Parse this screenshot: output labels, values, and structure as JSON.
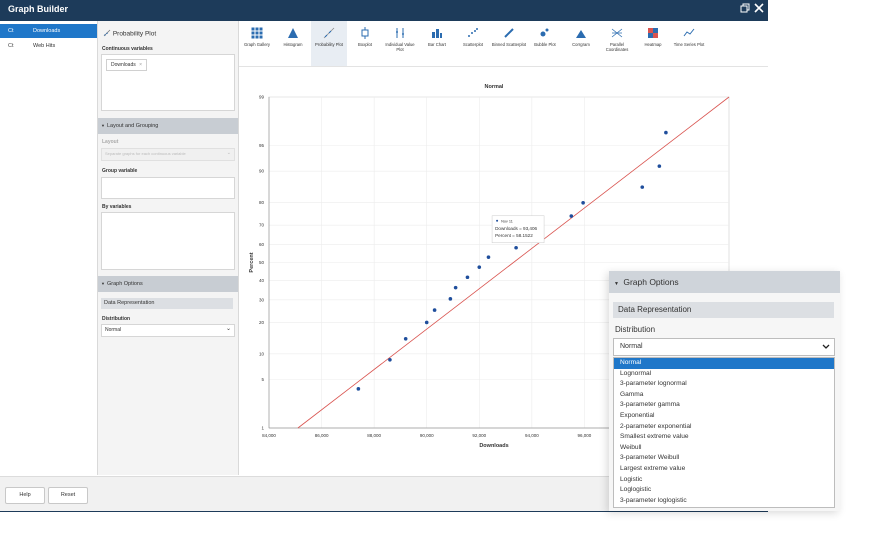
{
  "window": {
    "title": "Graph Builder"
  },
  "variables": [
    {
      "type": "Ct",
      "name": "Downloads",
      "selected": true
    },
    {
      "type": "Ct",
      "name": "Web Hits",
      "selected": false
    }
  ],
  "props": {
    "panel_title": "Probability Plot",
    "continuous_label": "Continuous variables",
    "continuous_chip": "Downloads",
    "layout_header": "Layout and Grouping",
    "layout_label": "Layout",
    "layout_placeholder": "Separate graphs for each continuous variable",
    "group_label": "Group variable",
    "by_label": "By variables",
    "graph_options_header": "Graph Options",
    "data_rep_label": "Data Representation",
    "distribution_label": "Distribution",
    "distribution_value": "Normal"
  },
  "toolbar": {
    "items": [
      {
        "label": "Graph Gallery",
        "icon": "grid-icon"
      },
      {
        "label": "Histogram",
        "icon": "histogram-icon"
      },
      {
        "label": "Probability Plot",
        "icon": "probability-plot-icon",
        "active": true
      },
      {
        "label": "Boxplot",
        "icon": "boxplot-icon"
      },
      {
        "label": "Individual Value Plot",
        "icon": "individual-value-icon"
      },
      {
        "label": "Bar Chart",
        "icon": "bar-chart-icon"
      },
      {
        "label": "Scatterplot",
        "icon": "scatterplot-icon"
      },
      {
        "label": "Binned Scatterplot",
        "icon": "binned-scatter-icon"
      },
      {
        "label": "Bubble Plot",
        "icon": "bubble-plot-icon"
      },
      {
        "label": "Corrgram",
        "icon": "corrgram-icon"
      },
      {
        "label": "Parallel Coordinates",
        "icon": "parallel-coordinates-icon"
      },
      {
        "label": "Heatmap",
        "icon": "heatmap-icon"
      },
      {
        "label": "Time Series Plot",
        "icon": "time-series-icon"
      }
    ],
    "accent": "#2b6cb0"
  },
  "chart_data": {
    "type": "scatter",
    "title": "Normal",
    "xlabel": "Downloads",
    "ylabel": "Percent",
    "x_ticks": [
      "84,000",
      "86,000",
      "88,000",
      "90,000",
      "92,000",
      "94,000",
      "96,000"
    ],
    "y_ticks": [
      "1",
      "5",
      "10",
      "20",
      "30",
      "40",
      "50",
      "60",
      "70",
      "80",
      "90",
      "95",
      "99"
    ],
    "xlim": [
      84000,
      101500
    ],
    "ylim_percent": [
      1,
      99
    ],
    "points": [
      {
        "x": 87400,
        "y": 3.8
      },
      {
        "x": 88600,
        "y": 8.6
      },
      {
        "x": 89200,
        "y": 14.2
      },
      {
        "x": 90000,
        "y": 20.0
      },
      {
        "x": 90300,
        "y": 25.2
      },
      {
        "x": 90900,
        "y": 30.5
      },
      {
        "x": 91100,
        "y": 36.2
      },
      {
        "x": 91550,
        "y": 41.8
      },
      {
        "x": 92000,
        "y": 47.4
      },
      {
        "x": 92350,
        "y": 53.0
      },
      {
        "x": 93400,
        "y": 58.2
      },
      {
        "x": 95500,
        "y": 74.3
      },
      {
        "x": 95950,
        "y": 79.9
      },
      {
        "x": 98200,
        "y": 85.5
      },
      {
        "x": 98850,
        "y": 91.2
      },
      {
        "x": 99100,
        "y": 96.6
      }
    ],
    "fit_line": [
      {
        "x": 85100,
        "y": 1
      },
      {
        "x": 101500,
        "y": 99
      }
    ],
    "point_color": "#1f4e9c",
    "line_color": "#d9534f",
    "grid": true,
    "tooltip": {
      "title": "Nov 11",
      "line1": "Downloads = 93,406",
      "line2": "Percent = 58.1522"
    }
  },
  "bottom": {
    "help": "Help",
    "reset": "Reset"
  },
  "zoom": {
    "header": "Graph Options",
    "section": "Data Representation",
    "label": "Distribution",
    "value": "Normal",
    "options": [
      "Normal",
      "Lognormal",
      "3-parameter lognormal",
      "Gamma",
      "3-parameter gamma",
      "Exponential",
      "2-parameter exponential",
      "Smallest extreme value",
      "Weibull",
      "3-parameter Weibull",
      "Largest extreme value",
      "Logistic",
      "Loglogistic",
      "3-parameter loglogistic"
    ],
    "selected_index": 0
  }
}
